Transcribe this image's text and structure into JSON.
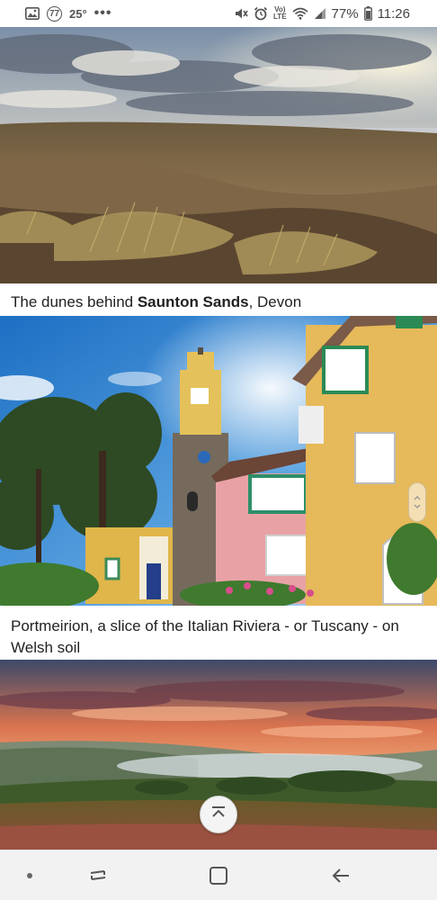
{
  "status_bar": {
    "badge_number": "77",
    "temperature": "25°",
    "more": "•••",
    "volte_top": "Vo)",
    "volte_bottom": "LTE",
    "battery_percent": "77%",
    "time": "11:26",
    "icons": [
      "gallery-icon",
      "mute-icon",
      "alarm-icon",
      "volte-icon",
      "wifi-icon",
      "signal-icon",
      "battery-icon"
    ]
  },
  "articles": [
    {
      "image": "sand-dunes-photo",
      "caption_prefix": "The dunes behind ",
      "caption_bold": "Saunton Sands",
      "caption_suffix": ", Devon"
    },
    {
      "image": "portmeirion-tower-photo",
      "caption": "Portmeirion, a slice of the Italian Riviera - or Tuscany - on Welsh soil"
    },
    {
      "image": "sunset-moorland-photo"
    }
  ],
  "controls": {
    "scroll_top_icon": "chevron-up-bar-icon",
    "scroll_handle_icon": "scroll-handle"
  },
  "nav_bar": {
    "items": [
      "dot-icon",
      "recents-icon",
      "home-icon",
      "back-icon"
    ],
    "background": "#f2f2f2"
  }
}
